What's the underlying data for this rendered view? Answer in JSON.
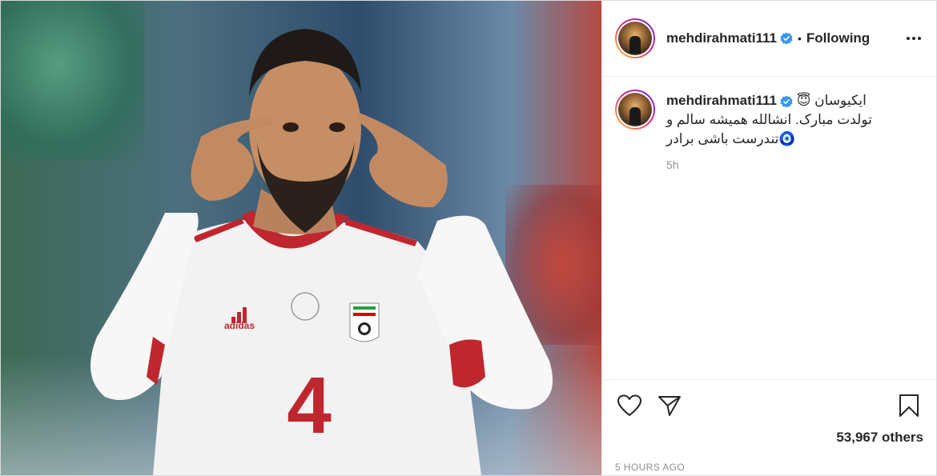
{
  "post": {
    "author": {
      "username": "mehdirahmati111",
      "verified": true,
      "follow_status": "Following",
      "separator": "•"
    },
    "media": {
      "jersey_number": "4",
      "jersey_brand": "adidas",
      "colors": {
        "jersey": "#f4f4f4",
        "trim": "#c0262e"
      }
    },
    "caption": {
      "line1": "ایکیوسان 😇",
      "line2": "تولدت مبارک. انشالله همیشه سالم و",
      "line3": "🧿تندرست باشی برادر",
      "relative_time": "5h"
    },
    "engagement": {
      "likes_label": "53,967 others",
      "timestamp": "5 HOURS AGO"
    },
    "icons": {
      "more": "more-dots-icon",
      "like": "heart-icon",
      "share": "paper-plane-icon",
      "save": "bookmark-icon",
      "verified": "verified-badge-icon"
    },
    "colors": {
      "verified_blue": "#3897f0",
      "text": "#262626",
      "muted": "#8e8e8e",
      "border": "#dbdbdb"
    }
  }
}
